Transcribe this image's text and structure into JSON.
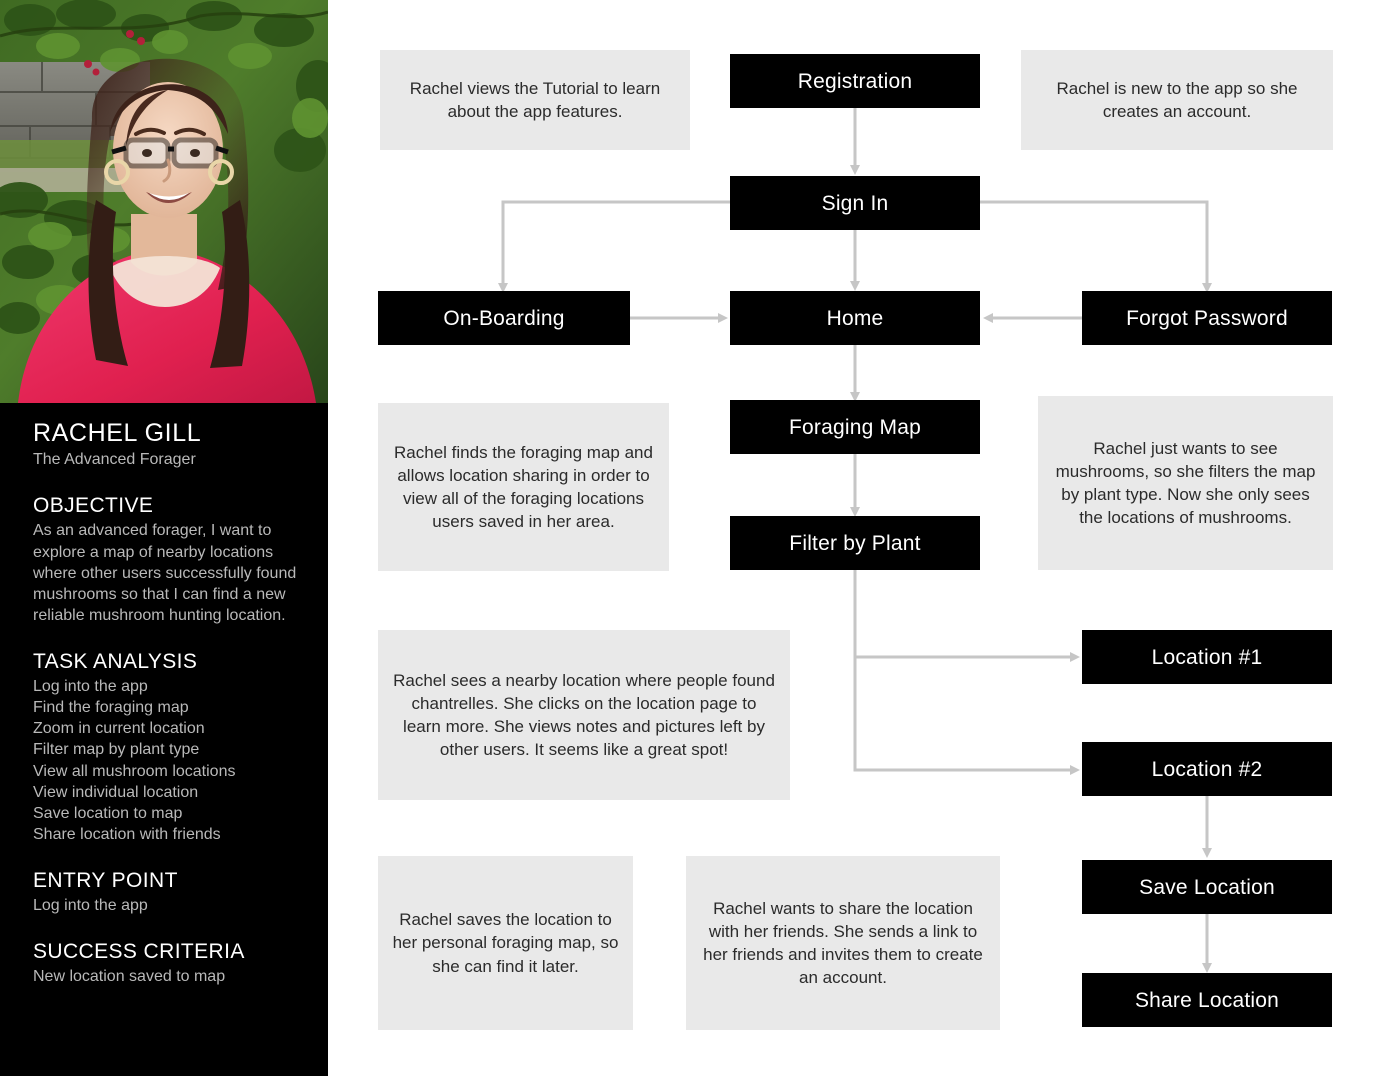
{
  "persona": {
    "name": "RACHEL GILL",
    "role": "The Advanced Forager",
    "objective_title": "OBJECTIVE",
    "objective_body": "As an advanced forager, I want to explore a map of nearby locations where other users successfully found mushrooms so that I can find a new reliable mushroom hunting location.",
    "task_title": "TASK ANALYSIS",
    "tasks": [
      "Log into the app",
      "Find the foraging map",
      "Zoom in current location",
      "Filter map by plant type",
      "View all mushroom locations",
      "View individual location",
      "Save location to map",
      "Share location with friends"
    ],
    "entry_title": "ENTRY POINT",
    "entry_body": "Log into the app",
    "success_title": "SUCCESS CRITERIA",
    "success_body": "New location saved to map",
    "photo_alt": "persona-portrait"
  },
  "flow": {
    "nodes": [
      {
        "id": "registration",
        "label": "Registration"
      },
      {
        "id": "sign-in",
        "label": "Sign In"
      },
      {
        "id": "on-boarding",
        "label": "On-Boarding"
      },
      {
        "id": "home",
        "label": "Home"
      },
      {
        "id": "forgot-password",
        "label": "Forgot Password"
      },
      {
        "id": "foraging-map",
        "label": "Foraging Map"
      },
      {
        "id": "filter-by-plant",
        "label": "Filter by Plant"
      },
      {
        "id": "location-1",
        "label": "Location #1"
      },
      {
        "id": "location-2",
        "label": "Location #2"
      },
      {
        "id": "save-location",
        "label": "Save Location"
      },
      {
        "id": "share-location",
        "label": "Share Location"
      }
    ],
    "notes": [
      {
        "id": "note-tutorial",
        "text": "Rachel views the Tutorial to learn about the app features."
      },
      {
        "id": "note-new-user",
        "text": "Rachel is new to the app so she creates an account."
      },
      {
        "id": "note-finds-map",
        "text": "Rachel finds the foraging map and allows location sharing in order to view all of the foraging locations users saved in her area."
      },
      {
        "id": "note-filter",
        "text": "Rachel just wants to see mushrooms, so she filters the map by plant type. Now she only sees the locations of mushrooms."
      },
      {
        "id": "note-chantrelles",
        "text": "Rachel sees a nearby location where people found chantrelles. She clicks on the location page to learn more. She views notes and pictures left by other users. It seems like a great spot!"
      },
      {
        "id": "note-save",
        "text": "Rachel saves the location to her personal foraging map, so she can find it later."
      },
      {
        "id": "note-share",
        "text": "Rachel wants to share the location with her friends. She sends a link to her friends and invites them to create an account."
      }
    ]
  },
  "colors": {
    "node_bg": "#000000",
    "node_text": "#ffffff",
    "note_bg": "#e9e9e9",
    "note_text": "#2b2b2b",
    "arrow": "#c6c6c6",
    "panel_bg": "#000000",
    "panel_text": "#b9b9b9",
    "shirt": "#e8295b"
  }
}
